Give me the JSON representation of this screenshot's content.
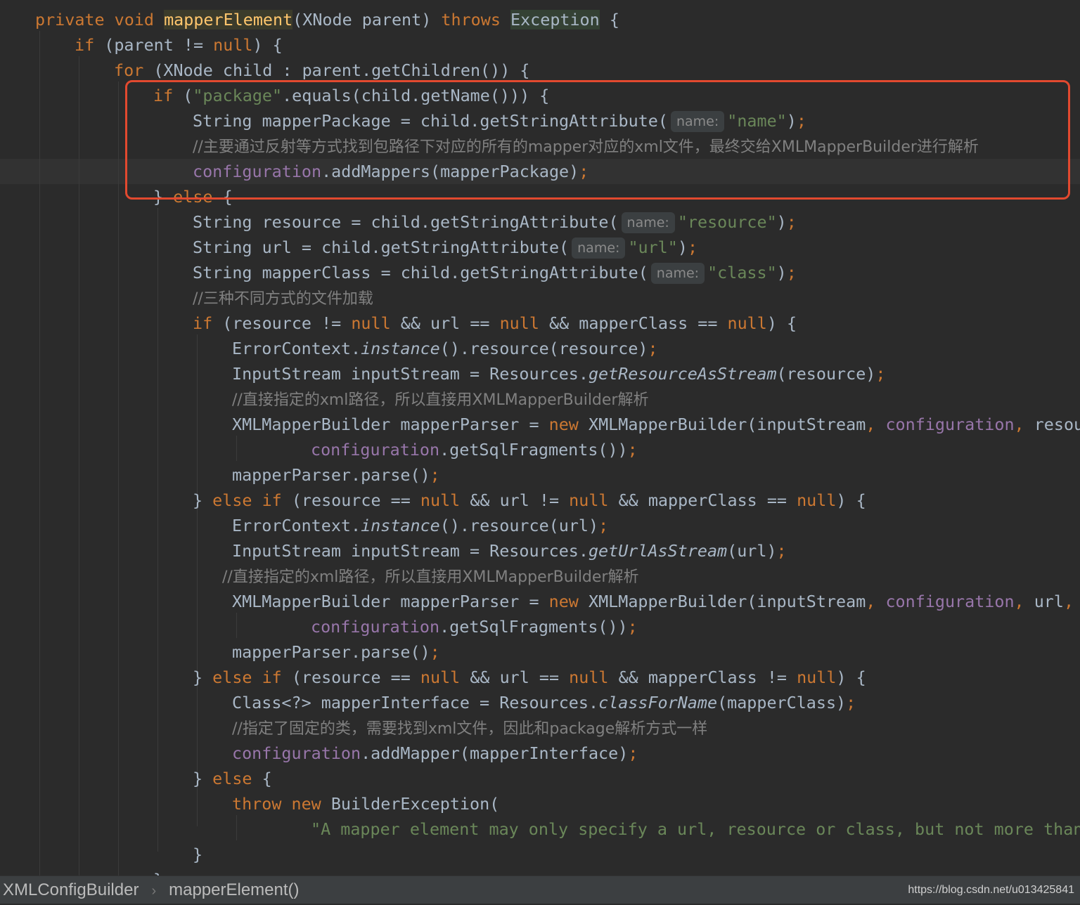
{
  "editor": {
    "colors": {
      "background": "#2b2b2b",
      "keyword": "#cc7832",
      "plain": "#a9b7c6",
      "field": "#9876aa",
      "string": "#6a8759",
      "comment": "#808080",
      "highlight_box": "#e2492f"
    },
    "lines": [
      {
        "indent": 1,
        "tokens": [
          {
            "t": "private void ",
            "c": "kw"
          },
          {
            "t": "mapperElement",
            "c": "method hl2"
          },
          {
            "t": "(XNode parent) ",
            "c": "plain"
          },
          {
            "t": "throws ",
            "c": "kw"
          },
          {
            "t": "Exception",
            "c": "plain hl"
          },
          {
            "t": " {",
            "c": "plain"
          }
        ]
      },
      {
        "indent": 2,
        "tokens": [
          {
            "t": "if ",
            "c": "kw"
          },
          {
            "t": "(parent != ",
            "c": "plain"
          },
          {
            "t": "null",
            "c": "kw"
          },
          {
            "t": ") {",
            "c": "plain"
          }
        ]
      },
      {
        "indent": 3,
        "tokens": [
          {
            "t": "for ",
            "c": "kw"
          },
          {
            "t": "(XNode child : parent.getChildren()) {",
            "c": "plain"
          }
        ]
      },
      {
        "indent": 4,
        "tokens": [
          {
            "t": "if ",
            "c": "kw"
          },
          {
            "t": "(",
            "c": "plain"
          },
          {
            "t": "\"package\"",
            "c": "str"
          },
          {
            "t": ".equals(child.getName())) {",
            "c": "plain"
          }
        ]
      },
      {
        "indent": 5,
        "tokens": [
          {
            "t": "String mapperPackage = child.getStringAttribute(",
            "c": "plain"
          },
          {
            "t": "name:",
            "c": "hint"
          },
          {
            "t": "\"name\"",
            "c": "str"
          },
          {
            "t": ")",
            "c": "plain"
          },
          {
            "t": ";",
            "c": "kw"
          }
        ]
      },
      {
        "indent": 5,
        "tokens": [
          {
            "t": "//主要通过反射等方式找到包路径下对应的所有的mapper对应的xml文件，最终交给XMLMapperBuilder进行解析",
            "c": "comment"
          }
        ]
      },
      {
        "indent": 5,
        "caret": true,
        "tokens": [
          {
            "t": "configuration",
            "c": "field"
          },
          {
            "t": ".addMappers(mapperPackage)",
            "c": "plain"
          },
          {
            "t": ";",
            "c": "kw"
          }
        ]
      },
      {
        "indent": 4,
        "tokens": [
          {
            "t": "} ",
            "c": "plain"
          },
          {
            "t": "else ",
            "c": "kw"
          },
          {
            "t": "{",
            "c": "plain"
          }
        ]
      },
      {
        "indent": 5,
        "tokens": [
          {
            "t": "String resource = child.getStringAttribute(",
            "c": "plain"
          },
          {
            "t": "name:",
            "c": "hint"
          },
          {
            "t": "\"resource\"",
            "c": "str"
          },
          {
            "t": ")",
            "c": "plain"
          },
          {
            "t": ";",
            "c": "kw"
          }
        ]
      },
      {
        "indent": 5,
        "tokens": [
          {
            "t": "String url = child.getStringAttribute(",
            "c": "plain"
          },
          {
            "t": "name:",
            "c": "hint"
          },
          {
            "t": "\"url\"",
            "c": "str"
          },
          {
            "t": ")",
            "c": "plain"
          },
          {
            "t": ";",
            "c": "kw"
          }
        ]
      },
      {
        "indent": 5,
        "tokens": [
          {
            "t": "String mapperClass = child.getStringAttribute(",
            "c": "plain"
          },
          {
            "t": "name:",
            "c": "hint"
          },
          {
            "t": "\"class\"",
            "c": "str"
          },
          {
            "t": ")",
            "c": "plain"
          },
          {
            "t": ";",
            "c": "kw"
          }
        ]
      },
      {
        "indent": 5,
        "tokens": [
          {
            "t": "//三种不同方式的文件加载",
            "c": "comment"
          }
        ]
      },
      {
        "indent": 5,
        "tokens": [
          {
            "t": "if ",
            "c": "kw"
          },
          {
            "t": "(resource != ",
            "c": "plain"
          },
          {
            "t": "null ",
            "c": "kw"
          },
          {
            "t": "&& url == ",
            "c": "plain"
          },
          {
            "t": "null ",
            "c": "kw"
          },
          {
            "t": "&& mapperClass == ",
            "c": "plain"
          },
          {
            "t": "null",
            "c": "kw"
          },
          {
            "t": ") {",
            "c": "plain"
          }
        ]
      },
      {
        "indent": 6,
        "tokens": [
          {
            "t": "ErrorContext.",
            "c": "plain"
          },
          {
            "t": "instance",
            "c": "italic"
          },
          {
            "t": "().resource(resource)",
            "c": "plain"
          },
          {
            "t": ";",
            "c": "kw"
          }
        ]
      },
      {
        "indent": 6,
        "tokens": [
          {
            "t": "InputStream inputStream = Resources.",
            "c": "plain"
          },
          {
            "t": "getResourceAsStream",
            "c": "italic"
          },
          {
            "t": "(resource)",
            "c": "plain"
          },
          {
            "t": ";",
            "c": "kw"
          }
        ]
      },
      {
        "indent": 6,
        "tokens": [
          {
            "t": "//直接指定的xml路径，所以直接用XMLMapperBuilder解析",
            "c": "comment"
          }
        ]
      },
      {
        "indent": 6,
        "tokens": [
          {
            "t": "XMLMapperBuilder mapperParser = ",
            "c": "plain"
          },
          {
            "t": "new ",
            "c": "kw"
          },
          {
            "t": "XMLMapperBuilder(inputStream",
            "c": "plain"
          },
          {
            "t": ", ",
            "c": "kw"
          },
          {
            "t": "configuration",
            "c": "field"
          },
          {
            "t": ", ",
            "c": "kw"
          },
          {
            "t": "resou",
            "c": "plain"
          }
        ]
      },
      {
        "indent": 8,
        "tokens": [
          {
            "t": "configuration",
            "c": "field"
          },
          {
            "t": ".getSqlFragments())",
            "c": "plain"
          },
          {
            "t": ";",
            "c": "kw"
          }
        ]
      },
      {
        "indent": 6,
        "tokens": [
          {
            "t": "mapperParser.parse()",
            "c": "plain"
          },
          {
            "t": ";",
            "c": "kw"
          }
        ]
      },
      {
        "indent": 5,
        "tokens": [
          {
            "t": "} ",
            "c": "plain"
          },
          {
            "t": "else if ",
            "c": "kw"
          },
          {
            "t": "(resource == ",
            "c": "plain"
          },
          {
            "t": "null ",
            "c": "kw"
          },
          {
            "t": "&& url != ",
            "c": "plain"
          },
          {
            "t": "null ",
            "c": "kw"
          },
          {
            "t": "&& mapperClass == ",
            "c": "plain"
          },
          {
            "t": "null",
            "c": "kw"
          },
          {
            "t": ") {",
            "c": "plain"
          }
        ]
      },
      {
        "indent": 6,
        "tokens": [
          {
            "t": "ErrorContext.",
            "c": "plain"
          },
          {
            "t": "instance",
            "c": "italic"
          },
          {
            "t": "().resource(url)",
            "c": "plain"
          },
          {
            "t": ";",
            "c": "kw"
          }
        ]
      },
      {
        "indent": 6,
        "tokens": [
          {
            "t": "InputStream inputStream = Resources.",
            "c": "plain"
          },
          {
            "t": "getUrlAsStream",
            "c": "italic"
          },
          {
            "t": "(url)",
            "c": "plain"
          },
          {
            "t": ";",
            "c": "kw"
          }
        ]
      },
      {
        "indent": 5.75,
        "tokens": [
          {
            "t": "//直接指定的xml路径，所以直接用XMLMapperBuilder解析",
            "c": "comment"
          }
        ]
      },
      {
        "indent": 6,
        "tokens": [
          {
            "t": "XMLMapperBuilder mapperParser = ",
            "c": "plain"
          },
          {
            "t": "new ",
            "c": "kw"
          },
          {
            "t": "XMLMapperBuilder(inputStream",
            "c": "plain"
          },
          {
            "t": ", ",
            "c": "kw"
          },
          {
            "t": "configuration",
            "c": "field"
          },
          {
            "t": ", ",
            "c": "kw"
          },
          {
            "t": "url",
            "c": "plain"
          },
          {
            "t": ",",
            "c": "kw"
          }
        ]
      },
      {
        "indent": 8,
        "tokens": [
          {
            "t": "configuration",
            "c": "field"
          },
          {
            "t": ".getSqlFragments())",
            "c": "plain"
          },
          {
            "t": ";",
            "c": "kw"
          }
        ]
      },
      {
        "indent": 6,
        "tokens": [
          {
            "t": "mapperParser.parse()",
            "c": "plain"
          },
          {
            "t": ";",
            "c": "kw"
          }
        ]
      },
      {
        "indent": 5,
        "tokens": [
          {
            "t": "} ",
            "c": "plain"
          },
          {
            "t": "else if ",
            "c": "kw"
          },
          {
            "t": "(resource == ",
            "c": "plain"
          },
          {
            "t": "null ",
            "c": "kw"
          },
          {
            "t": "&& url == ",
            "c": "plain"
          },
          {
            "t": "null ",
            "c": "kw"
          },
          {
            "t": "&& mapperClass != ",
            "c": "plain"
          },
          {
            "t": "null",
            "c": "kw"
          },
          {
            "t": ") {",
            "c": "plain"
          }
        ]
      },
      {
        "indent": 6,
        "tokens": [
          {
            "t": "Class<?> mapperInterface = Resources.",
            "c": "plain"
          },
          {
            "t": "classForName",
            "c": "italic"
          },
          {
            "t": "(mapperClass)",
            "c": "plain"
          },
          {
            "t": ";",
            "c": "kw"
          }
        ]
      },
      {
        "indent": 6,
        "tokens": [
          {
            "t": "//指定了固定的类，需要找到xml文件，因此和package解析方式一样",
            "c": "comment"
          }
        ]
      },
      {
        "indent": 6,
        "tokens": [
          {
            "t": "configuration",
            "c": "field"
          },
          {
            "t": ".addMapper(mapperInterface)",
            "c": "plain"
          },
          {
            "t": ";",
            "c": "kw"
          }
        ]
      },
      {
        "indent": 5,
        "tokens": [
          {
            "t": "} ",
            "c": "plain"
          },
          {
            "t": "else ",
            "c": "kw"
          },
          {
            "t": "{",
            "c": "plain"
          }
        ]
      },
      {
        "indent": 6,
        "tokens": [
          {
            "t": "throw new ",
            "c": "kw"
          },
          {
            "t": "BuilderException(",
            "c": "plain"
          }
        ]
      },
      {
        "indent": 8,
        "tokens": [
          {
            "t": "\"A mapper element may only specify a url, resource or class, but not more than",
            "c": "str"
          }
        ]
      },
      {
        "indent": 5,
        "tokens": [
          {
            "t": "}",
            "c": "plain"
          }
        ]
      },
      {
        "indent": 4,
        "tokens": [
          {
            "t": "}",
            "c": "plain"
          }
        ]
      }
    ]
  },
  "statusbar": {
    "breadcrumb_class": "XMLConfigBuilder",
    "breadcrumb_separator": "›",
    "breadcrumb_method": "mapperElement()",
    "watermark": "https://blog.csdn.net/u013425841"
  }
}
